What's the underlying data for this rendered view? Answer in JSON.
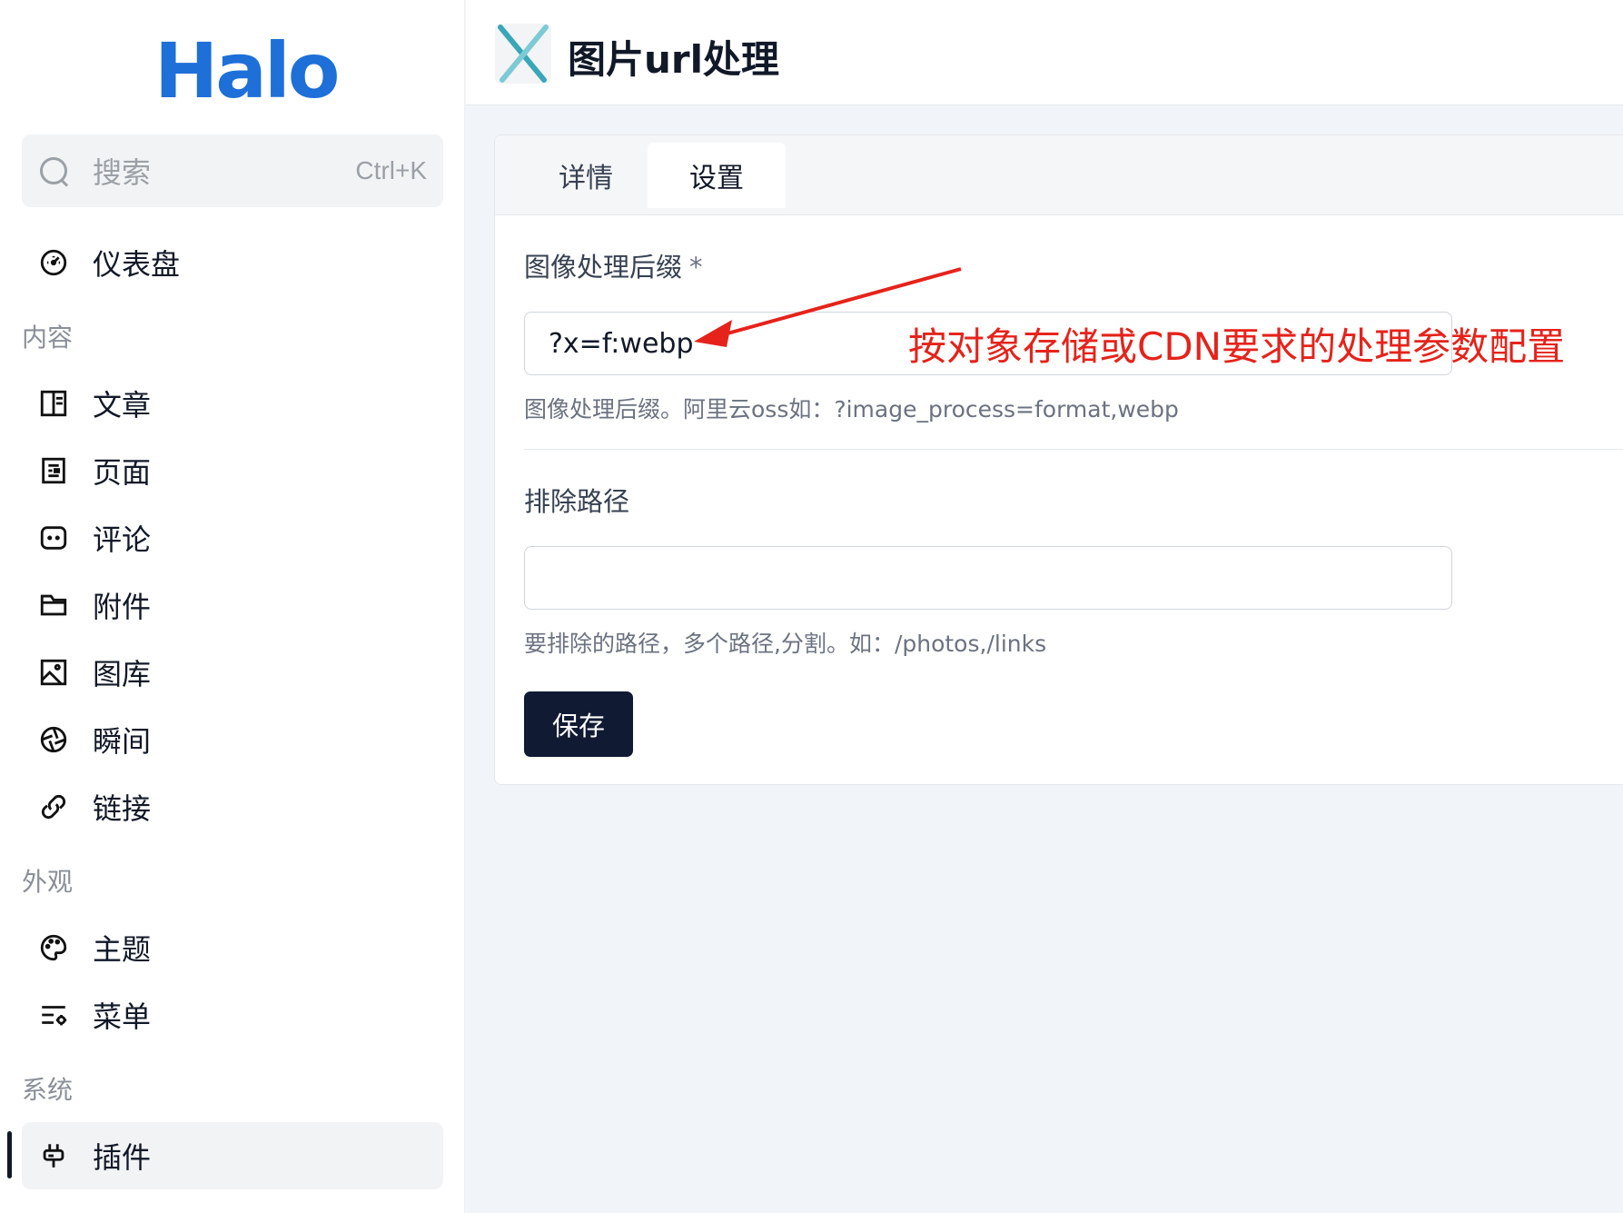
{
  "sidebar": {
    "logo": "Halo",
    "search": {
      "placeholder": "搜索",
      "shortcut": "Ctrl+K"
    },
    "dashboard": {
      "label": "仪表盘",
      "icon": "dashboard-icon"
    },
    "sections": [
      {
        "title": "内容",
        "items": [
          {
            "label": "文章",
            "icon": "post-icon"
          },
          {
            "label": "页面",
            "icon": "page-icon"
          },
          {
            "label": "评论",
            "icon": "comment-icon"
          },
          {
            "label": "附件",
            "icon": "folder-icon"
          },
          {
            "label": "图库",
            "icon": "image-icon"
          },
          {
            "label": "瞬间",
            "icon": "aperture-icon"
          },
          {
            "label": "链接",
            "icon": "link-icon"
          }
        ]
      },
      {
        "title": "外观",
        "items": [
          {
            "label": "主题",
            "icon": "palette-icon"
          },
          {
            "label": "菜单",
            "icon": "menu-settings-icon"
          }
        ]
      },
      {
        "title": "系统",
        "items": [
          {
            "label": "插件",
            "icon": "plug-icon",
            "active": true
          }
        ]
      }
    ]
  },
  "header": {
    "title": "图片url处理"
  },
  "tabs": [
    {
      "label": "详情",
      "active": false
    },
    {
      "label": "设置",
      "active": true
    }
  ],
  "form": {
    "suffix": {
      "label": "图像处理后缀",
      "required_mark": "*",
      "value": "?x=f:webp",
      "help": "图像处理后缀。阿里云oss如：?image_process=format,webp"
    },
    "exclude": {
      "label": "排除路径",
      "value": "",
      "help": "要排除的路径，多个路径,分割。如：/photos,/links"
    },
    "save_label": "保存"
  },
  "annotation": {
    "text": "按对象存储或CDN要求的处理参数配置",
    "color": "#e5231b"
  },
  "colors": {
    "brand": "#1e6fd8",
    "primary_button": "#111a33",
    "page_bg": "#f1f4f8"
  }
}
